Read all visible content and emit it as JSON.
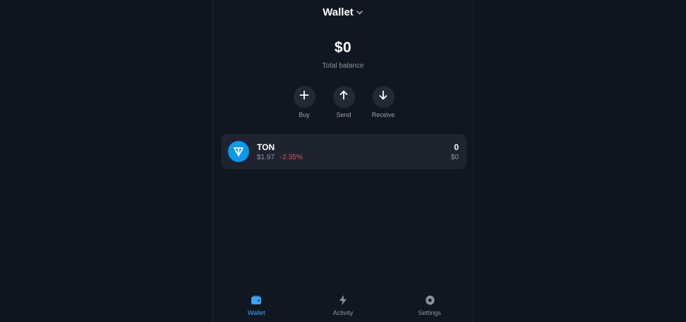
{
  "header": {
    "title": "Wallet",
    "chevron_icon": "chevron-down-icon"
  },
  "balance": {
    "amount": "$0",
    "label": "Total balance"
  },
  "actions": [
    {
      "label": "Buy",
      "icon": "plus-icon"
    },
    {
      "label": "Send",
      "icon": "arrow-up-icon"
    },
    {
      "label": "Receive",
      "icon": "arrow-down-icon"
    }
  ],
  "tokens": [
    {
      "name": "TON",
      "price": "$1.97",
      "change": "-2.35%",
      "amount": "0",
      "value": "$0",
      "icon": "ton-logo-icon"
    }
  ],
  "bottom_nav": [
    {
      "label": "Wallet",
      "icon": "wallet-icon",
      "active": true
    },
    {
      "label": "Activity",
      "icon": "lightning-icon",
      "active": false
    },
    {
      "label": "Settings",
      "icon": "gear-icon",
      "active": false
    }
  ],
  "colors": {
    "background": "#10161f",
    "panel": "#111720",
    "card": "#1d2430",
    "accent": "#3aa3f5",
    "ton_blue": "#0a98ea",
    "negative": "#e24a5a",
    "muted_text": "#8b94a3"
  }
}
